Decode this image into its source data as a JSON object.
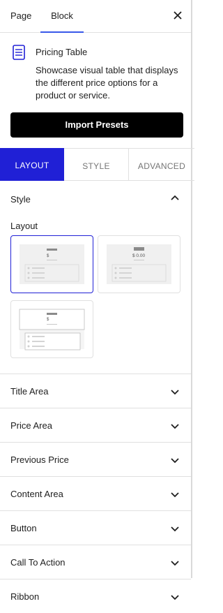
{
  "header": {
    "tabs": [
      {
        "label": "Page"
      },
      {
        "label": "Block"
      }
    ],
    "close_icon": "close-icon"
  },
  "block": {
    "icon": "pricing-table-icon",
    "title": "Pricing Table",
    "description": "Showcase visual table that displays the different price options for a product or service."
  },
  "import_presets_label": "Import Presets",
  "subtabs": [
    {
      "label": "LAYOUT"
    },
    {
      "label": "STYLE"
    },
    {
      "label": "ADVANCED"
    }
  ],
  "style_panel": {
    "title": "Style",
    "layout_label": "Layout",
    "layout_options": [
      {
        "price_text": "$",
        "selected": true
      },
      {
        "price_text": "$ 0.00",
        "selected": false
      },
      {
        "price_text": "$",
        "selected": false
      }
    ]
  },
  "accordion": [
    {
      "label": "Title Area"
    },
    {
      "label": "Price Area"
    },
    {
      "label": "Previous Price"
    },
    {
      "label": "Content Area"
    },
    {
      "label": "Button"
    },
    {
      "label": "Call To Action"
    },
    {
      "label": "Ribbon"
    }
  ],
  "colors": {
    "accent": "#2020d6",
    "tab_underline": "#3858e9",
    "button_bg": "#000000"
  }
}
